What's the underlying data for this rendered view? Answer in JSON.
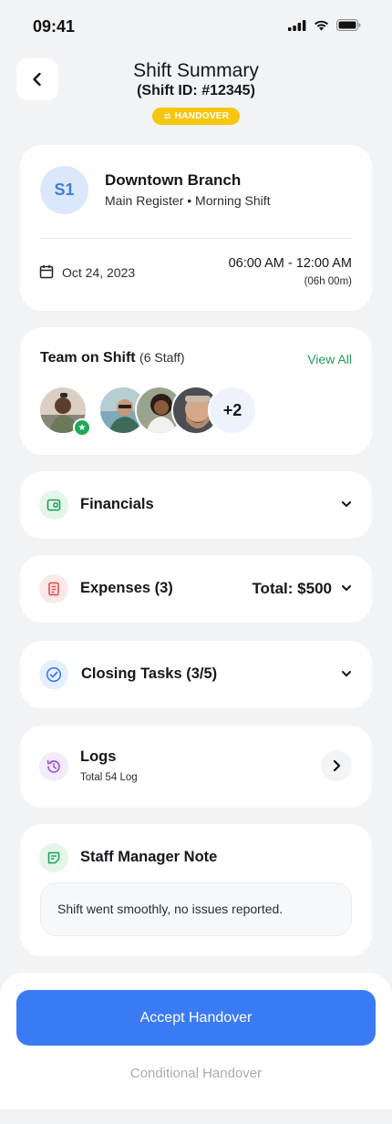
{
  "status": {
    "time": "09:41"
  },
  "header": {
    "title": "Shift Summary",
    "subtitle": "(Shift ID: #12345)",
    "badge": "HANDOVER"
  },
  "branch": {
    "initials": "S1",
    "name": "Downtown Branch",
    "detail": "Main Register • Morning Shift",
    "date": "Oct 24, 2023",
    "time_range": "06:00 AM - 12:00 AM",
    "duration": "(06h 00m)"
  },
  "team": {
    "title": "Team on Shift",
    "count": "(6 Staff)",
    "view_all": "View All",
    "more": "+2"
  },
  "sections": {
    "financials": "Financials",
    "expenses": "Expenses (3)",
    "expenses_total": "Total: $500",
    "closing_tasks": "Closing Tasks (3/5)",
    "logs": "Logs",
    "logs_sub": "Total 54 Log",
    "note_title": "Staff Manager Note",
    "note_text": "Shift went smoothly, no issues reported."
  },
  "actions": {
    "accept": "Accept Handover",
    "conditional": "Conditional Handover"
  },
  "colors": {
    "primary": "#3a7bf4",
    "badge": "#f7c611",
    "success": "#1f9e5a",
    "background": "#f2f3f5"
  }
}
